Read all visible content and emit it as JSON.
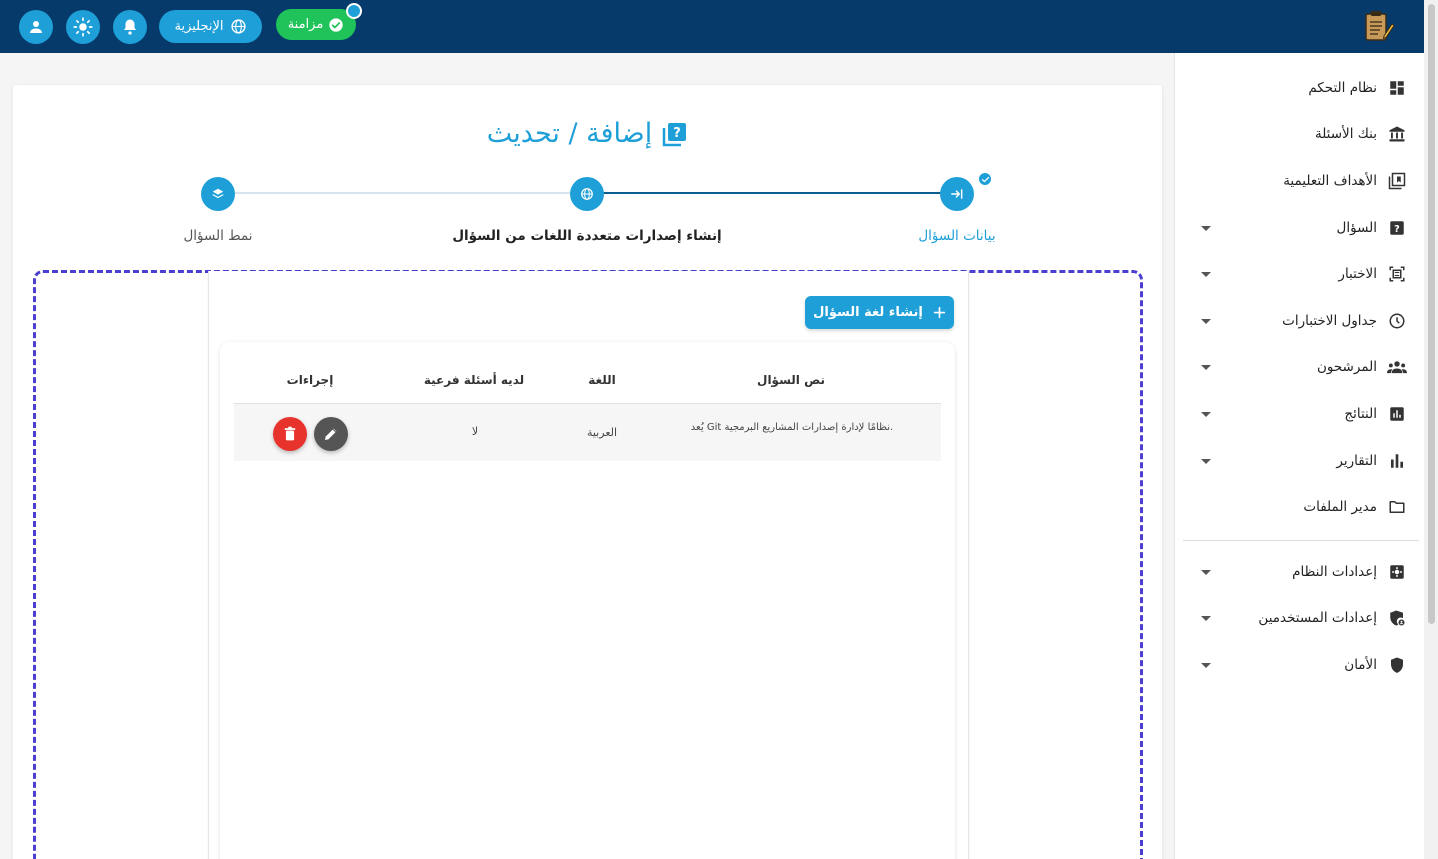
{
  "header": {
    "language_label": "الإنجليزية",
    "sync_label": "مزامنة",
    "icons": [
      "user-icon",
      "sun-icon",
      "bell-icon",
      "globe-icon",
      "check-circle-icon"
    ]
  },
  "sidebar": {
    "items": [
      {
        "label": "نظام التحكم",
        "icon": "dashboard-icon",
        "has_caret": false
      },
      {
        "label": "بنك الأسئلة",
        "icon": "bank-icon",
        "has_caret": false
      },
      {
        "label": "الأهداف التعليمية",
        "icon": "book-icon",
        "has_caret": false
      },
      {
        "label": "السؤال",
        "icon": "question-icon",
        "has_caret": true
      },
      {
        "label": "الاختبار",
        "icon": "exam-icon",
        "has_caret": true
      },
      {
        "label": "جداول الاختبارات",
        "icon": "clock-icon",
        "has_caret": true
      },
      {
        "label": "المرشحون",
        "icon": "people-icon",
        "has_caret": true
      },
      {
        "label": "النتائج",
        "icon": "results-icon",
        "has_caret": true
      },
      {
        "label": "التقارير",
        "icon": "bar-chart-icon",
        "has_caret": true
      },
      {
        "label": "مدير الملفات",
        "icon": "folder-icon",
        "has_caret": false
      },
      {
        "label": "إعدادات النظام",
        "icon": "settings-icon",
        "has_caret": true
      },
      {
        "label": "إعدادات المستخدمين",
        "icon": "user-shield-icon",
        "has_caret": true
      },
      {
        "label": "الأمان",
        "icon": "shield-icon",
        "has_caret": true
      }
    ]
  },
  "page": {
    "title": "إضافة / تحديث"
  },
  "stepper": {
    "steps": [
      {
        "label": "بيانات السؤال",
        "state": "done"
      },
      {
        "label": "إنشاء إصدارات متعددة اللغات من السؤال",
        "state": "active"
      },
      {
        "label": "نمط السؤال",
        "state": "todo"
      }
    ]
  },
  "create_button_label": "إنشاء لغة السؤال",
  "table": {
    "headers": {
      "text": "نص السؤال",
      "language": "اللغة",
      "has_sub": "لديه أسئلة فرعية",
      "actions": "إجراءات"
    },
    "rows": [
      {
        "text": "يُعد Git نظامًا لإدارة إصدارات المشاريع البرمجية.",
        "language": "العربية",
        "has_sub": "لا"
      }
    ]
  },
  "colors": {
    "header_bg": "#053a6b",
    "accent": "#1e9fd8",
    "sync_green": "#20c35a",
    "delete_red": "#e8332c",
    "edit_gray": "#555555",
    "dashed_border": "#4a3fd0"
  }
}
